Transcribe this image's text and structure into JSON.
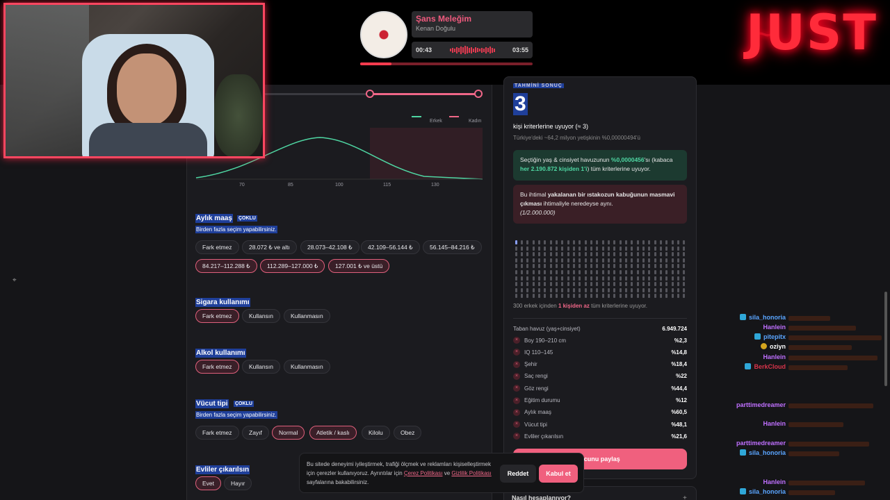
{
  "music": {
    "title": "Şans Meleğim",
    "artist": "Kenan Doğulu",
    "elapsed": "00:43",
    "total": "03:55",
    "progress_fraction": 0.18
  },
  "logo": {
    "text": "JUST"
  },
  "chart": {
    "legend": [
      "Erkek",
      "Kadın"
    ],
    "ticks": [
      "70",
      "85",
      "100",
      "115",
      "130"
    ]
  },
  "salary": {
    "title": "Aylık maaş",
    "badge": "ÇOKLU",
    "subtitle": "Birden fazla seçim yapabilirsiniz.",
    "options": [
      "Fark etmez",
      "28.072 ₺ ve altı",
      "28.073–42.108 ₺",
      "42.109–56.144 ₺",
      "56.145–84.216 ₺",
      "84.217–112.288 ₺",
      "112.289–127.000 ₺",
      "127.001 ₺ ve üstü"
    ]
  },
  "smoking": {
    "title": "Sigara kullanımı",
    "options": [
      "Fark etmez",
      "Kullansın",
      "Kullanmasın"
    ]
  },
  "alcohol": {
    "title": "Alkol kullanımı",
    "options": [
      "Fark etmez",
      "Kullansın",
      "Kullanmasın"
    ]
  },
  "body": {
    "title": "Vücut tipi",
    "badge": "ÇOKLU",
    "subtitle": "Birden fazla seçim yapabilirsiniz.",
    "options": [
      "Fark etmez",
      "Zayıf",
      "Normal",
      "Atletik / kaslı",
      "Kilolu",
      "Obez"
    ]
  },
  "married": {
    "title": "Evliler çıkarılsın",
    "options": [
      "Evet",
      "Hayır"
    ]
  },
  "result": {
    "header": "TAHMİNİ SONUÇ",
    "count": "3",
    "line1": "kişi kriterlerine uyuyor (≈ 3)",
    "line2": "Türkiye'deki ~64,2 milyon yetişkinin %0,00000494'ü",
    "green_pre": "Seçtiğin yaş & cinsiyet havuzunun ",
    "green_pct": "%0,0000456",
    "green_mid": "'sı (kabaca ",
    "green_bold": "her 2.190.872 kişiden 1'i",
    "green_post": ") tüm kriterlerine uyuyor.",
    "red_pre": "Bu ihtimal ",
    "red_bold": "yakalanan bir ıstakozun kabuğunun masmavi çıkması",
    "red_post": " ihtimaliyle neredeyse aynı.",
    "red_ratio": "(1/2.000.000)",
    "note_pre": "300 erkek içinden ",
    "note_bold": "1 kişiden az",
    "note_post": " tüm kriterlerine uyuyor.",
    "base_label": "Taban havuz (yaş+cinsiyet)",
    "base_value": "6.949.724",
    "rows": [
      {
        "label": "Boy 190–210 cm",
        "value": "%2,3"
      },
      {
        "label": "IQ 110–145",
        "value": "%14,8"
      },
      {
        "label": "Şehir",
        "value": "%18,4"
      },
      {
        "label": "Saç rengi",
        "value": "%22"
      },
      {
        "label": "Göz rengi",
        "value": "%44,4"
      },
      {
        "label": "Eğitim durumu",
        "value": "%12"
      },
      {
        "label": "Aylık maaş",
        "value": "%60,5"
      },
      {
        "label": "Vücut tipi",
        "value": "%48,1"
      },
      {
        "label": "Evliler çıkarılsın",
        "value": "%21,6"
      }
    ],
    "share": "ucunu paylaş",
    "howto": "Nasıl hesaplanıyor?",
    "howto_icon": "+"
  },
  "cookie": {
    "text1": "Bu sitede deneyimi iyileştirmek, trafiği ölçmek ve reklamları kişiselleştirmek için çerezler kullanıyoruz. Ayrıntılar için ",
    "link1": "Çerez Politikası",
    "text2": " ve ",
    "link2": "Gizlilik Politikası",
    "text3": " sayfalarına bakabilirsiniz.",
    "reject": "Reddet",
    "accept": "Kabul et"
  },
  "chat": [
    {
      "user": "sila_honoria",
      "color": "#5aa5ff",
      "icon": "sub-badge"
    },
    {
      "user": "Hanlein",
      "color": "#c070ff",
      "icon": ""
    },
    {
      "user": "pitepitx",
      "color": "#5aa5ff",
      "icon": "sub-badge"
    },
    {
      "user": "oziyn",
      "color": "#ffffff",
      "icon": "gold-badge"
    },
    {
      "user": "Hanlein",
      "color": "#c070ff",
      "icon": ""
    },
    {
      "user": "BerkCloud",
      "color": "#d8344a",
      "icon": "sub-badge"
    },
    {
      "user": "parttimedreamer",
      "color": "#c070ff",
      "icon": ""
    },
    {
      "user": "Hanlein",
      "color": "#c070ff",
      "icon": ""
    },
    {
      "user": "parttimedreamer",
      "color": "#c070ff",
      "icon": ""
    },
    {
      "user": "sila_honoria",
      "color": "#5aa5ff",
      "icon": "sub-badge"
    },
    {
      "user": "Hanlein",
      "color": "#c070ff",
      "icon": ""
    },
    {
      "user": "sila_honoria",
      "color": "#5aa5ff",
      "icon": "sub-badge"
    }
  ],
  "colors": {
    "accent": "#f06788",
    "highlight": "#1f3f9a",
    "green": "#4fd7a3"
  }
}
